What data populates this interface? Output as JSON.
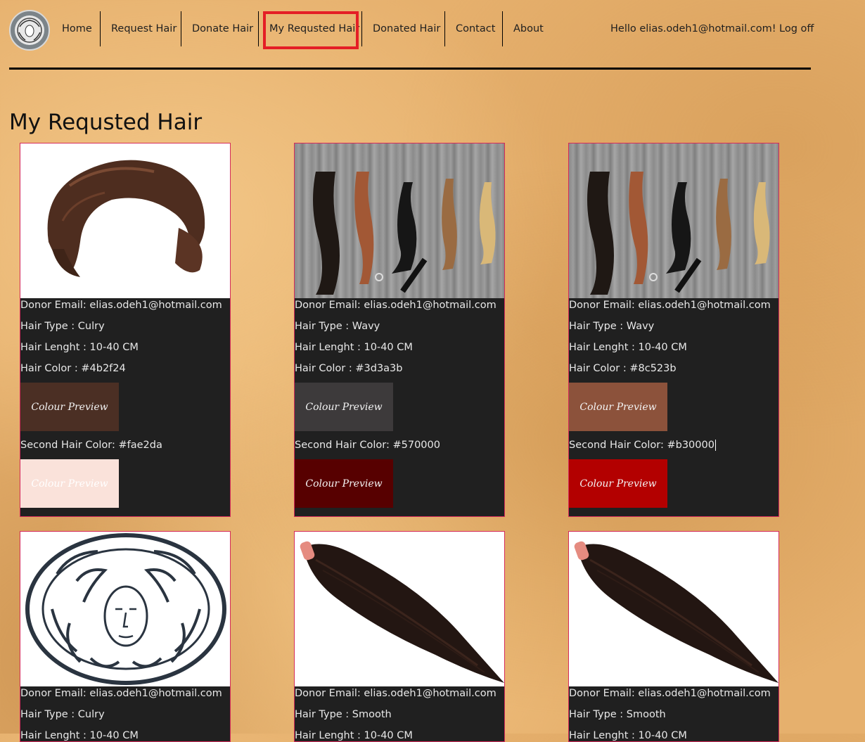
{
  "nav": {
    "items": [
      "Home",
      "Request Hair",
      "Donate Hair",
      "My Requsted Hair",
      "Donated Hair",
      "Contact",
      "About"
    ],
    "greeting": "Hello elias.odeh1@hotmail.com!",
    "logoff": "Log off"
  },
  "page_title": "My Requsted Hair",
  "labels": {
    "donor": "Donor Email: ",
    "type": "Hair Type : ",
    "length": "Hair Lenght : ",
    "color": "Hair Color : ",
    "second": "Second Hair Color: ",
    "preview": "Colour Preview"
  },
  "cards": [
    {
      "image": "short-brown-wig",
      "email": "elias.odeh1@hotmail.com",
      "type": "Culry",
      "length": "10-40 CM",
      "color": "#4b2f24",
      "second": "#fae2da"
    },
    {
      "image": "hair-bundles-on-wood",
      "email": "elias.odeh1@hotmail.com",
      "type": "Wavy",
      "length": "10-40 CM",
      "color": "#3d3a3b",
      "second": "#570000"
    },
    {
      "image": "hair-bundles-on-wood",
      "email": "elias.odeh1@hotmail.com",
      "type": "Wavy",
      "length": "10-40 CM",
      "color": "#8c523b",
      "second": "#b30000"
    },
    {
      "image": "medusa-logo",
      "email": "elias.odeh1@hotmail.com",
      "type": "Culry",
      "length": "10-40 CM",
      "color": "",
      "second": ""
    },
    {
      "image": "straight-dark-ponytail",
      "email": "elias.odeh1@hotmail.com",
      "type": "Smooth",
      "length": "10-40 CM",
      "color": "",
      "second": ""
    },
    {
      "image": "straight-dark-ponytail",
      "email": "elias.odeh1@hotmail.com",
      "type": "Smooth",
      "length": "10-40 CM",
      "color": "",
      "second": ""
    }
  ]
}
